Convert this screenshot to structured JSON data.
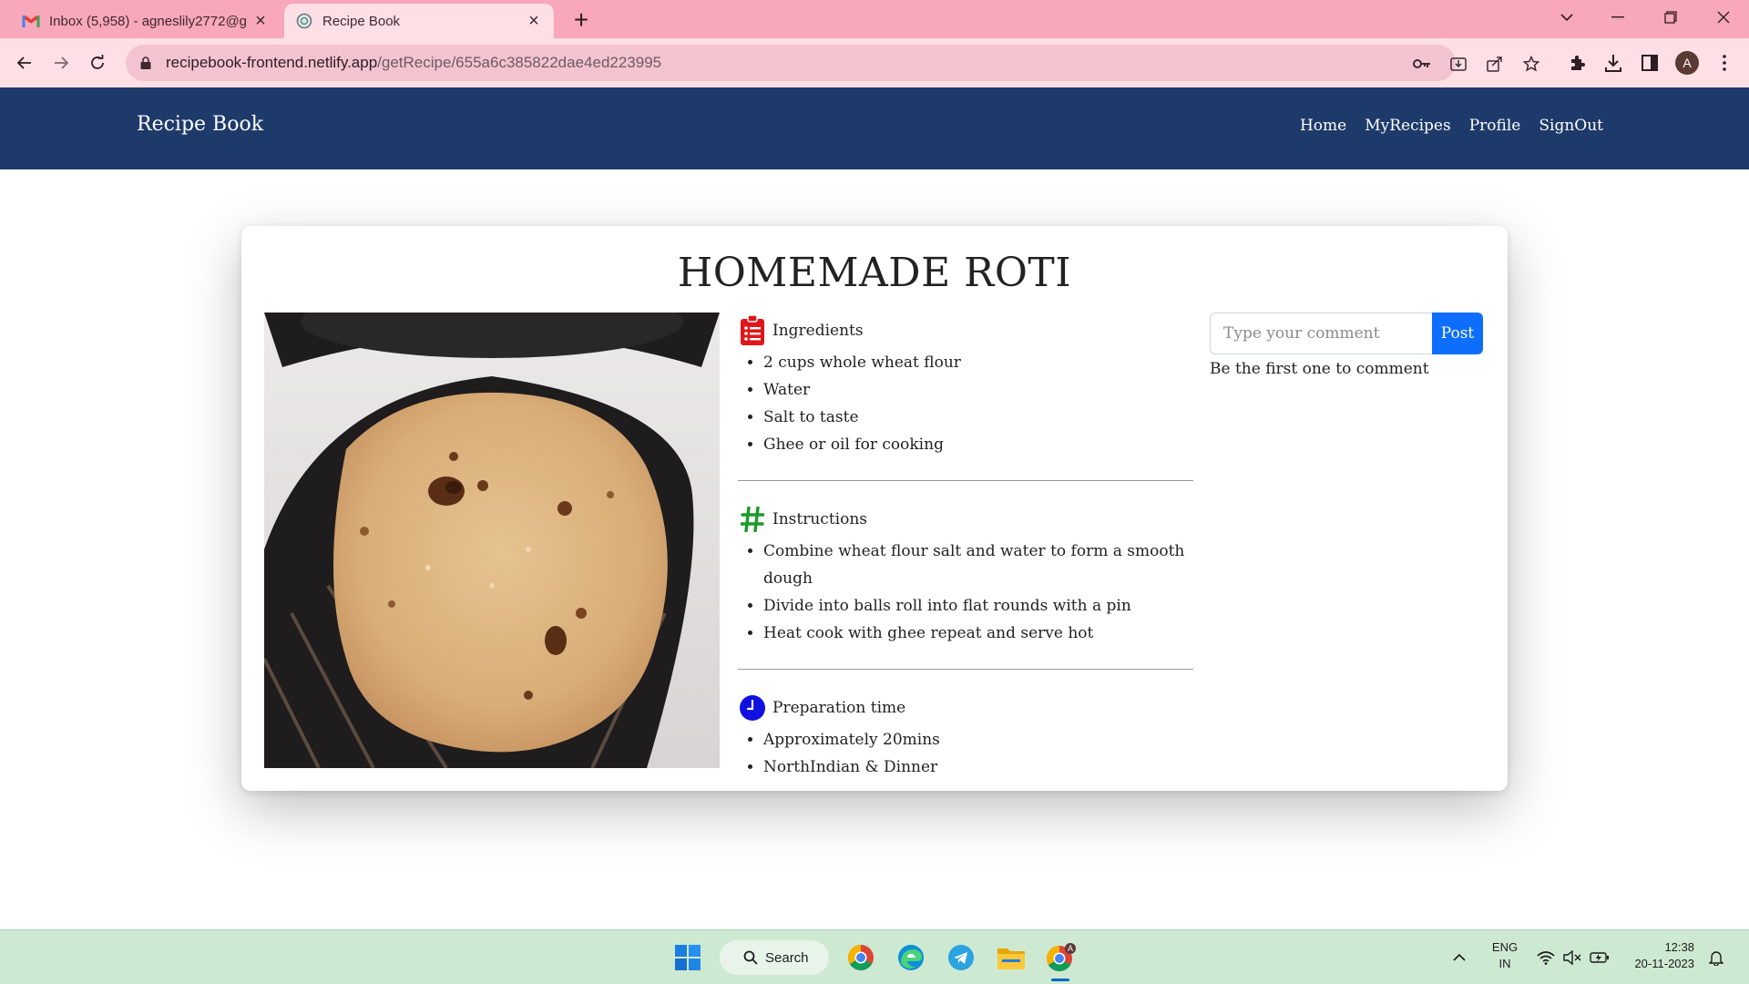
{
  "browser": {
    "tabs": [
      {
        "title": "Inbox (5,958) - agneslily2772@g",
        "icon": "gmail-icon",
        "active": false
      },
      {
        "title": "Recipe Book",
        "icon": "globe-icon",
        "active": true
      }
    ],
    "url_host": "recipebook-frontend.netlify.app",
    "url_path": "/getRecipe/655a6c385822dae4ed223995",
    "profile_initial": "A"
  },
  "site": {
    "brand": "Recipe Book",
    "nav": [
      "Home",
      "MyRecipes",
      "Profile",
      "SignOut"
    ]
  },
  "recipe": {
    "title": "HOMEMADE ROTI",
    "ingredients": {
      "label": "Ingredients",
      "items": [
        "2 cups whole wheat flour",
        "Water",
        "Salt to taste",
        "Ghee or oil for cooking"
      ]
    },
    "instructions": {
      "label": "Instructions",
      "items": [
        "Combine wheat flour salt and water to form a smooth dough",
        "Divide into balls roll into flat rounds with a pin",
        "Heat cook with ghee repeat and serve hot"
      ]
    },
    "preparation": {
      "label": "Preparation time",
      "items": [
        "Approximately 20mins",
        "NorthIndian & Dinner"
      ]
    }
  },
  "comments": {
    "placeholder": "Type your comment",
    "post_label": "Post",
    "empty_text": "Be the first one to comment"
  },
  "taskbar": {
    "search_label": "Search",
    "lang_line1": "ENG",
    "lang_line2": "IN",
    "time": "12:38",
    "date": "20-11-2023"
  },
  "colors": {
    "tabstrip": "#f9a7ba",
    "toolbar": "#ffdfe6",
    "navbar": "#1e3a6b",
    "post_button": "#0d6efd",
    "ingredients_icon": "#e0161b",
    "instructions_icon": "#1a9a2a",
    "preparation_icon": "#1010e0",
    "taskbar": "#cde9d2"
  }
}
